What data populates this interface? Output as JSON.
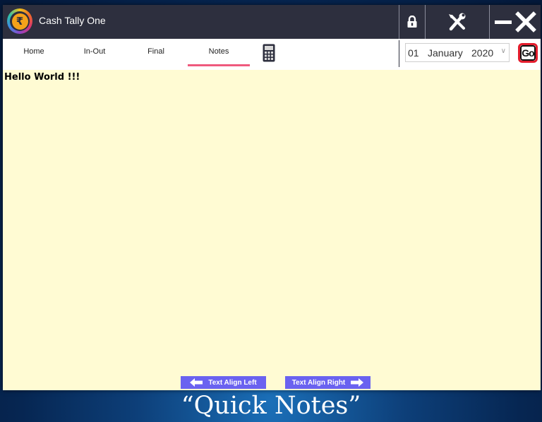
{
  "window": {
    "app_title": "Cash Tally One",
    "logo_symbol": "₹",
    "logo_icon": "rupee-logo-icon",
    "title_buttons": [
      {
        "icon": "lock-icon"
      },
      {
        "icon": "tools-icon"
      },
      {
        "icon": "minimize-icon"
      },
      {
        "icon": "close-icon"
      }
    ]
  },
  "tabs": {
    "items": [
      {
        "label": "Home"
      },
      {
        "label": "In-Out"
      },
      {
        "label": "Final"
      },
      {
        "label": "Notes"
      }
    ],
    "active": "Notes",
    "calculator_icon": "calculator-icon"
  },
  "date": {
    "day": "01",
    "month": "January",
    "year": "2020"
  },
  "go_button": {
    "label": "Go"
  },
  "notes": {
    "content": "Hello World !!!"
  },
  "footer": {
    "align_left_label": "Text Align Left",
    "align_right_label": "Text Align Right"
  },
  "caption": "“Quick Notes”",
  "colors": {
    "titlebar": "#2d2f3e",
    "notes_background": "#fffbd3",
    "active_tab_underline": "#ef5a7d",
    "align_button": "#6a62f0",
    "go_border": "#e41d2d"
  }
}
